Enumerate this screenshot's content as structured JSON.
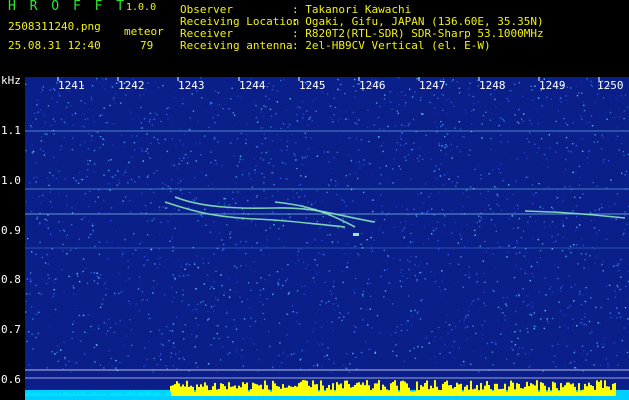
{
  "header": {
    "app_name": "H R O F F T",
    "version": "1.0.0",
    "filename": "2508311240.png",
    "datetime": "25.08.31 12:40",
    "meteor_label": "meteor",
    "meteor_count": "79"
  },
  "info": {
    "observer_label": "Observer",
    "observer_value": ": Takanori Kawachi",
    "location_label": "Receiving Location",
    "location_value": ": Ogaki, Gifu, JAPAN (136.60E, 35.35N)",
    "receiver_label": "Receiver",
    "receiver_value": ": R820T2(RTL-SDR) SDR-Sharp 53.1000MHz",
    "antenna_label": "Receiving antenna",
    "antenna_value": ": 2el-HB9CV Vertical (el. E-W)"
  },
  "axis": {
    "x_ticks": [
      "1241",
      "1242",
      "1243",
      "1244",
      "1245",
      "1246",
      "1247",
      "1248",
      "1249",
      "1250"
    ],
    "y_unit": "kHz",
    "y_ticks": [
      "1.1",
      "1.0",
      "0.9",
      "0.8",
      "0.7",
      "0.6"
    ]
  },
  "colors": {
    "background": "#000000",
    "spectrogram": "#0a1f8a",
    "noise_band": "#00cfff",
    "activity_bars": "#ffff00",
    "label_green": "#2ee82e",
    "label_yellow": "#f2f20a"
  }
}
